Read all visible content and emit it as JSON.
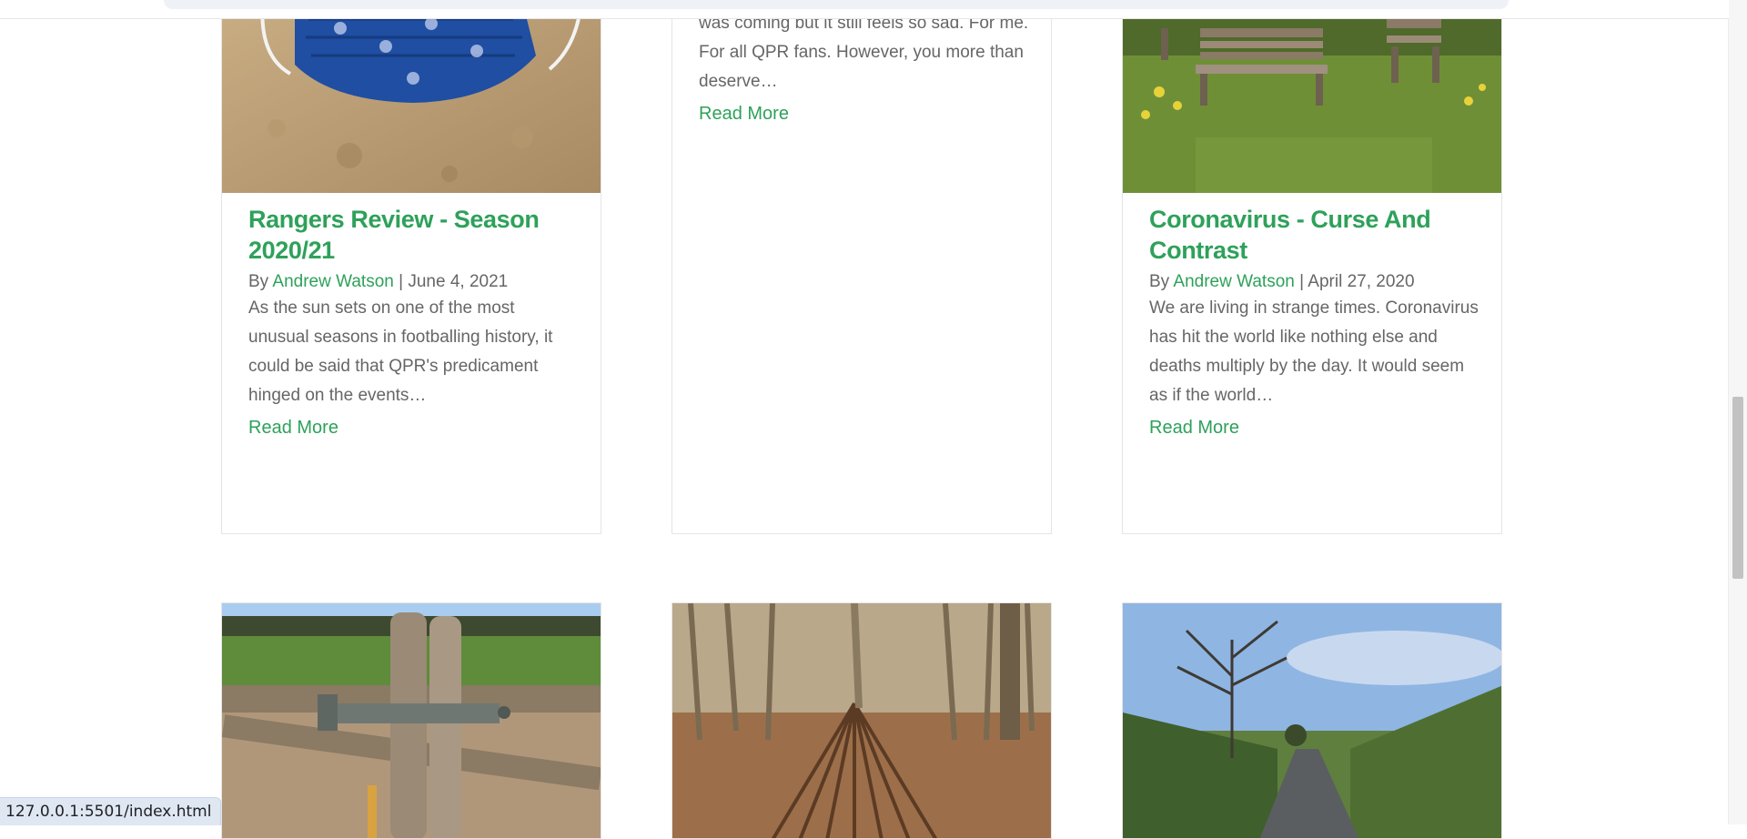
{
  "colors": {
    "accent": "#2ea15a",
    "text": "#666666",
    "border": "#e5e5e5"
  },
  "posts_row1": [
    {
      "title": "Rangers Review - Season 2020/21",
      "by": "By",
      "author": "Andrew Watson",
      "separator": "|",
      "date": "June 4, 2021",
      "excerpt": "As the sun sets on one of the most unusual seasons in footballing history, it could be said that QPR's predicament hinged on the events…",
      "read_more": "Read More",
      "image": "blue-face-mask-on-sand"
    },
    {
      "excerpt": "was coming but it still feels so sad. For me. For all QPR fans. However, you more than deserve…",
      "read_more": "Read More"
    },
    {
      "title": "Coronavirus - Curse And Contrast",
      "by": "By",
      "author": "Andrew Watson",
      "separator": "|",
      "date": "April 27, 2020",
      "excerpt": "We are living in strange times. Coronavirus has hit the world like nothing else and deaths multiply by the day. It would seem as if the world…",
      "read_more": "Read More",
      "image": "garden-benches-on-grass"
    }
  ],
  "posts_row2": [
    {
      "image": "wooden-gate-field"
    },
    {
      "image": "woodland-stick-shelter"
    },
    {
      "image": "country-lane-tree"
    }
  ],
  "status_bar": {
    "url": "127.0.0.1:5501/index.html"
  }
}
